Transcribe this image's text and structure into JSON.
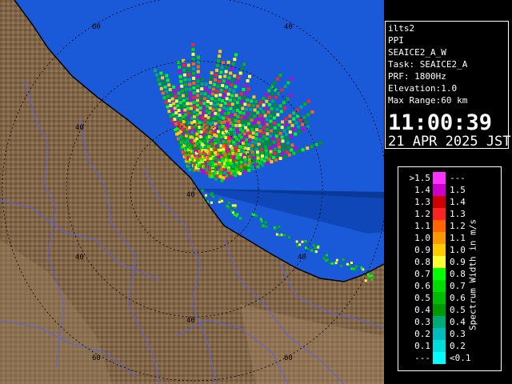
{
  "info": {
    "site": "ilts2",
    "product": "PPI",
    "scan": "SEAICE2_A_W",
    "task": "Task: SEAICE2_A",
    "prf": "PRF: 1800Hz",
    "elevation": "Elevation:1.0",
    "max_range": "Max Range:60 km",
    "time": "11:00:39",
    "date": "21 APR 2025 JST"
  },
  "range_labels": [
    "60",
    "40",
    "40",
    "40",
    "40",
    "60",
    "40",
    "60",
    "40"
  ],
  "legend": {
    "unit_label": "Spectrum Width in m/s",
    "rows": [
      {
        "lo": ">1.5",
        "hi": "---",
        "color": "#ff33ff"
      },
      {
        "lo": "1.4",
        "hi": "1.5",
        "color": "#cc00cc"
      },
      {
        "lo": "1.3",
        "hi": "1.4",
        "color": "#cc0000"
      },
      {
        "lo": "1.2",
        "hi": "1.3",
        "color": "#ff2222"
      },
      {
        "lo": "1.1",
        "hi": "1.2",
        "color": "#ff6600"
      },
      {
        "lo": "1.0",
        "hi": "1.1",
        "color": "#ff9900"
      },
      {
        "lo": "0.9",
        "hi": "1.0",
        "color": "#ffcc00"
      },
      {
        "lo": "0.8",
        "hi": "0.9",
        "color": "#ffff33"
      },
      {
        "lo": "0.7",
        "hi": "0.8",
        "color": "#00ff00"
      },
      {
        "lo": "0.6",
        "hi": "0.7",
        "color": "#00dd00"
      },
      {
        "lo": "0.5",
        "hi": "0.6",
        "color": "#00bb00"
      },
      {
        "lo": "0.4",
        "hi": "0.5",
        "color": "#009900"
      },
      {
        "lo": "0.3",
        "hi": "0.4",
        "color": "#00aa77"
      },
      {
        "lo": "0.2",
        "hi": "0.3",
        "color": "#00bbbb"
      },
      {
        "lo": "0.1",
        "hi": "0.2",
        "color": "#00dddd"
      },
      {
        "lo": "---",
        "hi": "<0.1",
        "color": "#00ffff"
      }
    ]
  },
  "colors": {
    "sea": "#1a5ad8",
    "land": "#7a6040",
    "range_ring": "#000000",
    "river": "#5560ff"
  }
}
